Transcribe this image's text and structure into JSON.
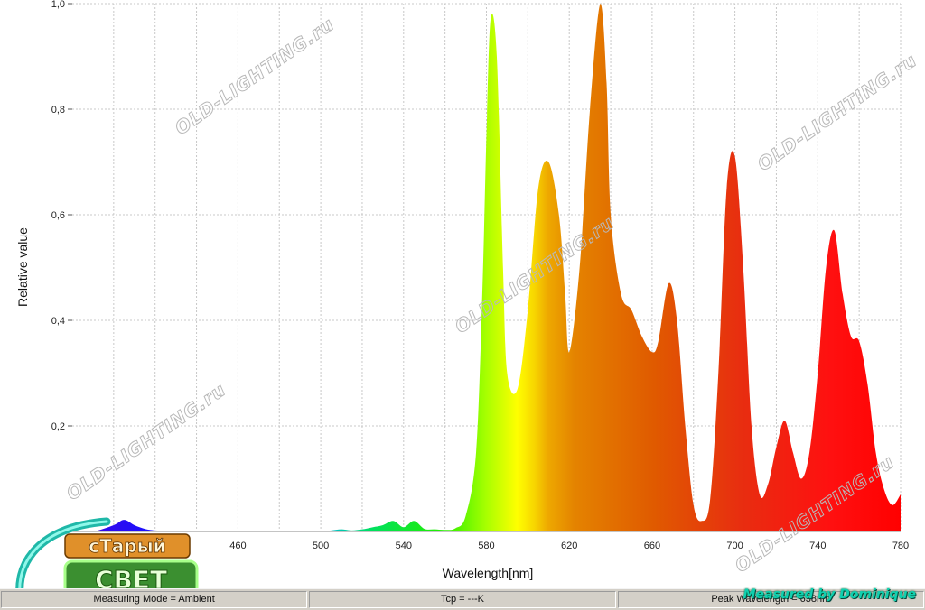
{
  "chart_data": {
    "type": "area",
    "xlabel": "Wavelength[nm]",
    "ylabel": "Relative value",
    "xlim": [
      380,
      780
    ],
    "ylim": [
      0,
      1
    ],
    "x_ticks": [
      "400",
      "420",
      "440",
      "460",
      "480",
      "500",
      "520",
      "540",
      "560",
      "580",
      "600",
      "620",
      "640",
      "660",
      "680",
      "700",
      "720",
      "740",
      "760",
      "780"
    ],
    "x_tick_labels_shown": [
      "",
      "",
      "",
      "460",
      "",
      "500",
      "",
      "540",
      "",
      "580",
      "",
      "620",
      "",
      "660",
      "",
      "700",
      "",
      "740",
      "",
      "780"
    ],
    "y_ticks": [
      "0",
      "0,2",
      "0,4",
      "0,6",
      "0,8",
      "1,0"
    ],
    "grid": true,
    "x": [
      380,
      390,
      400,
      405,
      410,
      415,
      420,
      430,
      440,
      450,
      460,
      470,
      480,
      490,
      500,
      505,
      510,
      515,
      520,
      525,
      530,
      535,
      540,
      545,
      550,
      555,
      560,
      565,
      570,
      575,
      578,
      580,
      582,
      585,
      588,
      590,
      595,
      600,
      605,
      610,
      615,
      618,
      620,
      625,
      630,
      635,
      638,
      640,
      645,
      650,
      655,
      660,
      663,
      668,
      672,
      676,
      680,
      684,
      688,
      692,
      696,
      700,
      704,
      708,
      712,
      716,
      720,
      724,
      728,
      732,
      736,
      740,
      744,
      748,
      752,
      756,
      760,
      764,
      768,
      772,
      776,
      780
    ],
    "values": [
      0,
      0,
      0.012,
      0.022,
      0.012,
      0.005,
      0.002,
      0,
      0,
      0,
      0,
      0,
      0,
      0,
      0,
      0.002,
      0.004,
      0.002,
      0.004,
      0.008,
      0.012,
      0.02,
      0.008,
      0.02,
      0.005,
      0.004,
      0.003,
      0.006,
      0.03,
      0.15,
      0.45,
      0.75,
      0.97,
      0.9,
      0.5,
      0.3,
      0.27,
      0.42,
      0.65,
      0.7,
      0.6,
      0.45,
      0.34,
      0.5,
      0.8,
      1.0,
      0.85,
      0.6,
      0.45,
      0.42,
      0.37,
      0.34,
      0.36,
      0.47,
      0.4,
      0.2,
      0.05,
      0.02,
      0.06,
      0.3,
      0.65,
      0.71,
      0.5,
      0.2,
      0.07,
      0.09,
      0.16,
      0.21,
      0.15,
      0.1,
      0.15,
      0.3,
      0.5,
      0.57,
      0.45,
      0.37,
      0.36,
      0.28,
      0.15,
      0.08,
      0.05,
      0.07
    ]
  },
  "watermarks": [
    "OLD-LIGHTING.ru",
    "OLD-LIGHTING.ru",
    "OLD-LIGHTING.ru",
    "OLD-LIGHTING.ru",
    "OLD-LIGHTING.ru"
  ],
  "logo": {
    "top": "сТарый",
    "bottom": "СВЕТ"
  },
  "signature": "Measured by Dominique",
  "status": {
    "mode": "Measuring Mode = Ambient",
    "tcp": "Tcp = ---K",
    "peak": "Peak Wavelength = 638nm"
  },
  "colors": {
    "gridline": "#c8c8c8",
    "status_bar": "#d4d0c8",
    "signature": "#10d0b0"
  }
}
